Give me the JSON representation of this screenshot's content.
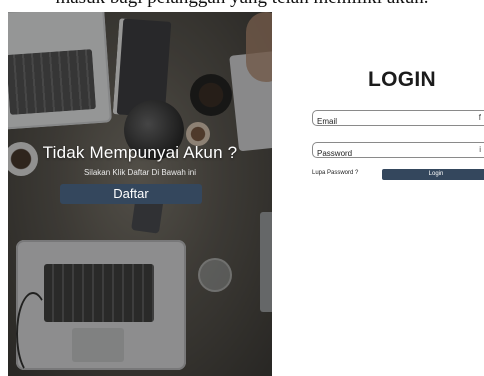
{
  "top_caption": "masuk bagi pelanggan yang telah memiliki akun.",
  "left_panel": {
    "headline": "Tidak Mempunyai Akun ?",
    "subline": "Silakan Klik Daftar Di Bawah ini",
    "register_button": "Daftar"
  },
  "login_form": {
    "title": "LOGIN",
    "email_placeholder": "Email",
    "password_placeholder": "Password",
    "forgot_password": "Lupa Password ?",
    "login_button": "Login",
    "email_icon": "f",
    "password_icon": "i"
  },
  "colors": {
    "button_bg": "#34475d",
    "title_text": "#1b1b1b"
  }
}
